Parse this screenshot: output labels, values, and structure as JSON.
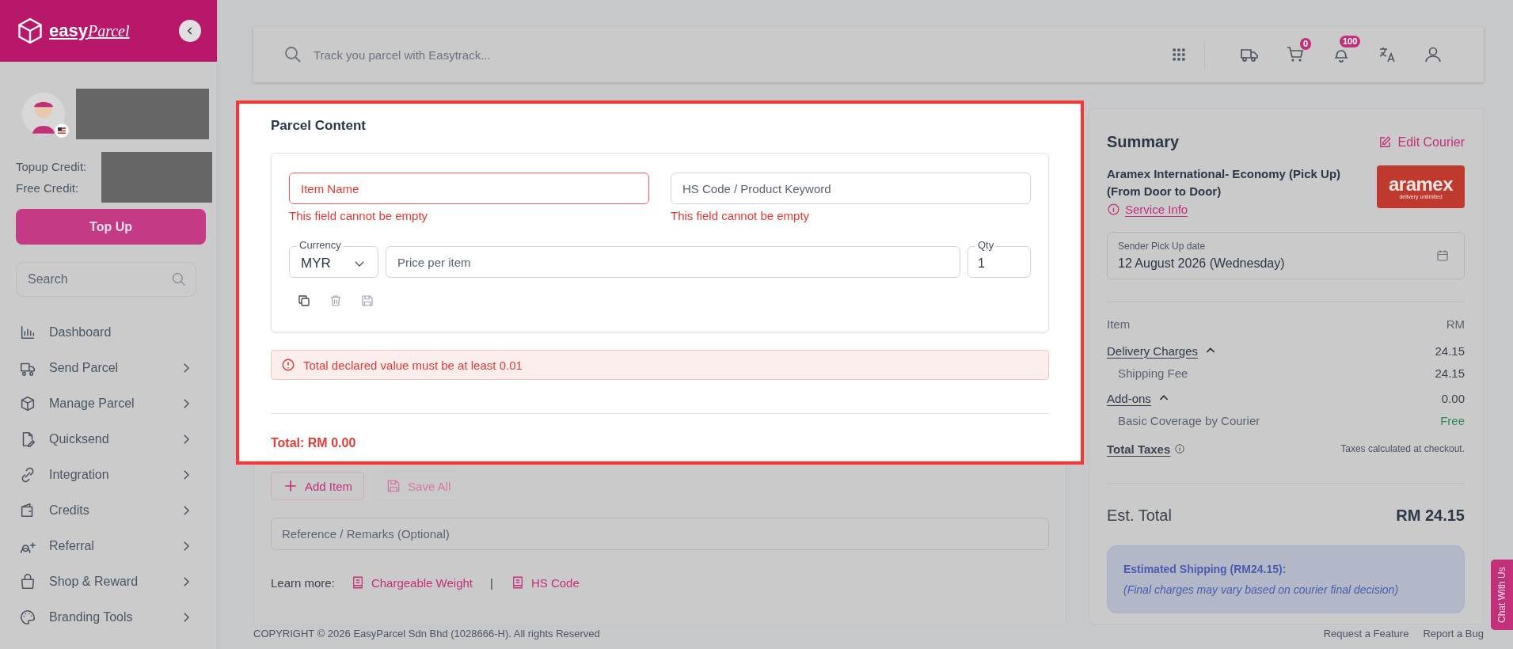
{
  "sidebar": {
    "brand": {
      "word_1": "easy",
      "word_2": "Parcel"
    },
    "credit_labels": [
      "Topup Credit:",
      "Free Credit:"
    ],
    "topup_button": "Top Up",
    "search": {
      "placeholder": "Search"
    },
    "nav": [
      {
        "label": "Dashboard",
        "expandable": false
      },
      {
        "label": "Send Parcel",
        "expandable": true
      },
      {
        "label": "Manage Parcel",
        "expandable": true
      },
      {
        "label": "Quicksend",
        "expandable": true
      },
      {
        "label": "Integration",
        "expandable": true
      },
      {
        "label": "Credits",
        "expandable": true
      },
      {
        "label": "Referral",
        "expandable": true
      },
      {
        "label": "Shop & Reward",
        "expandable": true
      },
      {
        "label": "Branding Tools",
        "expandable": true
      }
    ]
  },
  "topbar": {
    "search": {
      "placeholder": "Track you parcel with Easytrack..."
    },
    "cart_badge": "0",
    "notification_badge": "100"
  },
  "parcel_content": {
    "title": "Parcel Content",
    "fields": [
      {
        "placeholder": "Item Name",
        "error": "This field cannot be empty",
        "invalid": true
      },
      {
        "placeholder": "HS Code / Product Keyword",
        "error": "This field cannot be empty",
        "invalid": false
      }
    ],
    "currency": {
      "label": "Currency",
      "value": "MYR"
    },
    "price": {
      "placeholder": "Price per item"
    },
    "qty": {
      "label": "Qty",
      "value": "1"
    },
    "alert": "Total declared value must be at least 0.01",
    "total": "Total: RM 0.00"
  },
  "actions": {
    "add_item": "Add Item",
    "save_all": {
      "label": "Save All",
      "disabled": true
    }
  },
  "remarks": {
    "placeholder": "Reference / Remarks (Optional)"
  },
  "learn_more": {
    "label": "Learn more:",
    "links": [
      "Chargeable Weight",
      "HS Code"
    ],
    "separator": "|"
  },
  "summary": {
    "title": "Summary",
    "edit_link": "Edit Courier",
    "courier": "Aramex International- Economy (Pick Up) (From Door to Door)",
    "service_info": "Service Info",
    "logo": {
      "name": "aramex",
      "tagline": "delivery unlimited"
    },
    "date": {
      "label": "Sender Pick Up date",
      "value": "12 August 2026 (Wednesday)"
    },
    "header": {
      "item": "Item",
      "unit": "RM"
    },
    "rows": [
      {
        "kind": "group",
        "label": "Delivery Charges",
        "value": "24.15",
        "free": false
      },
      {
        "kind": "sub",
        "label": "Shipping Fee",
        "value": "24.15",
        "free": false
      },
      {
        "kind": "group",
        "label": "Add-ons",
        "value": "0.00",
        "free": false
      },
      {
        "kind": "sub",
        "label": "Basic Coverage by Courier",
        "value": "Free",
        "free": true
      }
    ],
    "taxes": {
      "label": "Total Taxes",
      "note": "Taxes calculated at checkout."
    },
    "est_total": {
      "label": "Est. Total",
      "value": "RM 24.15"
    },
    "notice": {
      "title": "Estimated Shipping (RM24.15):",
      "note": "(Final charges may vary based on courier final decision)"
    }
  },
  "footer": {
    "copyright": "COPYRIGHT © 2026 EasyParcel Sdn Bhd (1028666-H). All rights Reserved",
    "links": [
      "Request a Feature",
      "Report a Bug"
    ]
  },
  "chat_button": "Chat With Us"
}
